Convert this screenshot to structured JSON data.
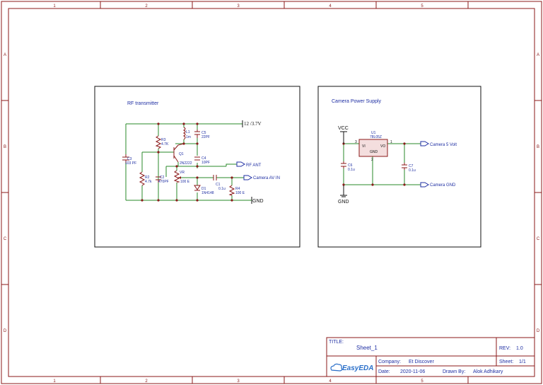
{
  "frame": {
    "columns": [
      "1",
      "2",
      "3",
      "4",
      "5"
    ],
    "rows": [
      "A",
      "B",
      "C",
      "D"
    ]
  },
  "rf": {
    "title": "RF transmitter",
    "supply": "12 /3.7V",
    "gnd": "GND",
    "rf_ant": "RF ANT",
    "cam_in": "Camera AV IN",
    "c3_ref": "C3",
    "c3_val": "103 PF",
    "r3_ref": "R3",
    "r3_val": "4.7K",
    "l1_ref": "L1",
    "l1_val": "1m",
    "c5_ref": "C5",
    "c5_val": "22PF",
    "q1_ref": "Q1",
    "q1_val": "2N2222",
    "c4_ref": "C4",
    "c4_val": "10PF",
    "r2_ref": "R2",
    "r2_val": "4.7k",
    "c2_ref": "C2",
    "c2_val": "470PF",
    "vr_ref": "VR",
    "vr_val": "100 E",
    "d1_ref": "D1",
    "d1_val": "1N4148",
    "c1_ref": "C1",
    "c1_val": "0.1u",
    "r4_ref": "R4",
    "r4_val": "100 E"
  },
  "ps": {
    "title": "Camera Power Supply",
    "vcc": "VCC",
    "gnd": "GND",
    "u1_ref": "U1",
    "u1_val": "78L05Z",
    "pin_vi": "VI",
    "pin_vo": "VO",
    "pin_gnd": "GND",
    "pin1": "1",
    "pin2": "2",
    "pin3": "3",
    "c6_ref": "C6",
    "c6_val": "0.1u",
    "c7_ref": "C7",
    "c7_val": "0.1u",
    "out_5v": "Camera 5 Volt",
    "out_gnd": "Camera GND"
  },
  "titleblock": {
    "title_label": "TITLE:",
    "title_value": "Sheet_1",
    "rev_label": "REV:",
    "rev_value": "1.0",
    "company_label": "Company:",
    "company_value": "Et Discover",
    "sheet_label": "Sheet:",
    "sheet_value": "1/1",
    "date_label": "Date:",
    "date_value": "2020-11-06",
    "drawn_label": "Drawn By:",
    "drawn_value": "Alok Adhikary",
    "logo_text": "EasyEDA"
  },
  "colors": {
    "frame": "#8b1a1a",
    "wire": "#2a8a2a",
    "component": "#8b1a1a",
    "label": "#1f2fa3",
    "junction": "#8b1a1a"
  }
}
